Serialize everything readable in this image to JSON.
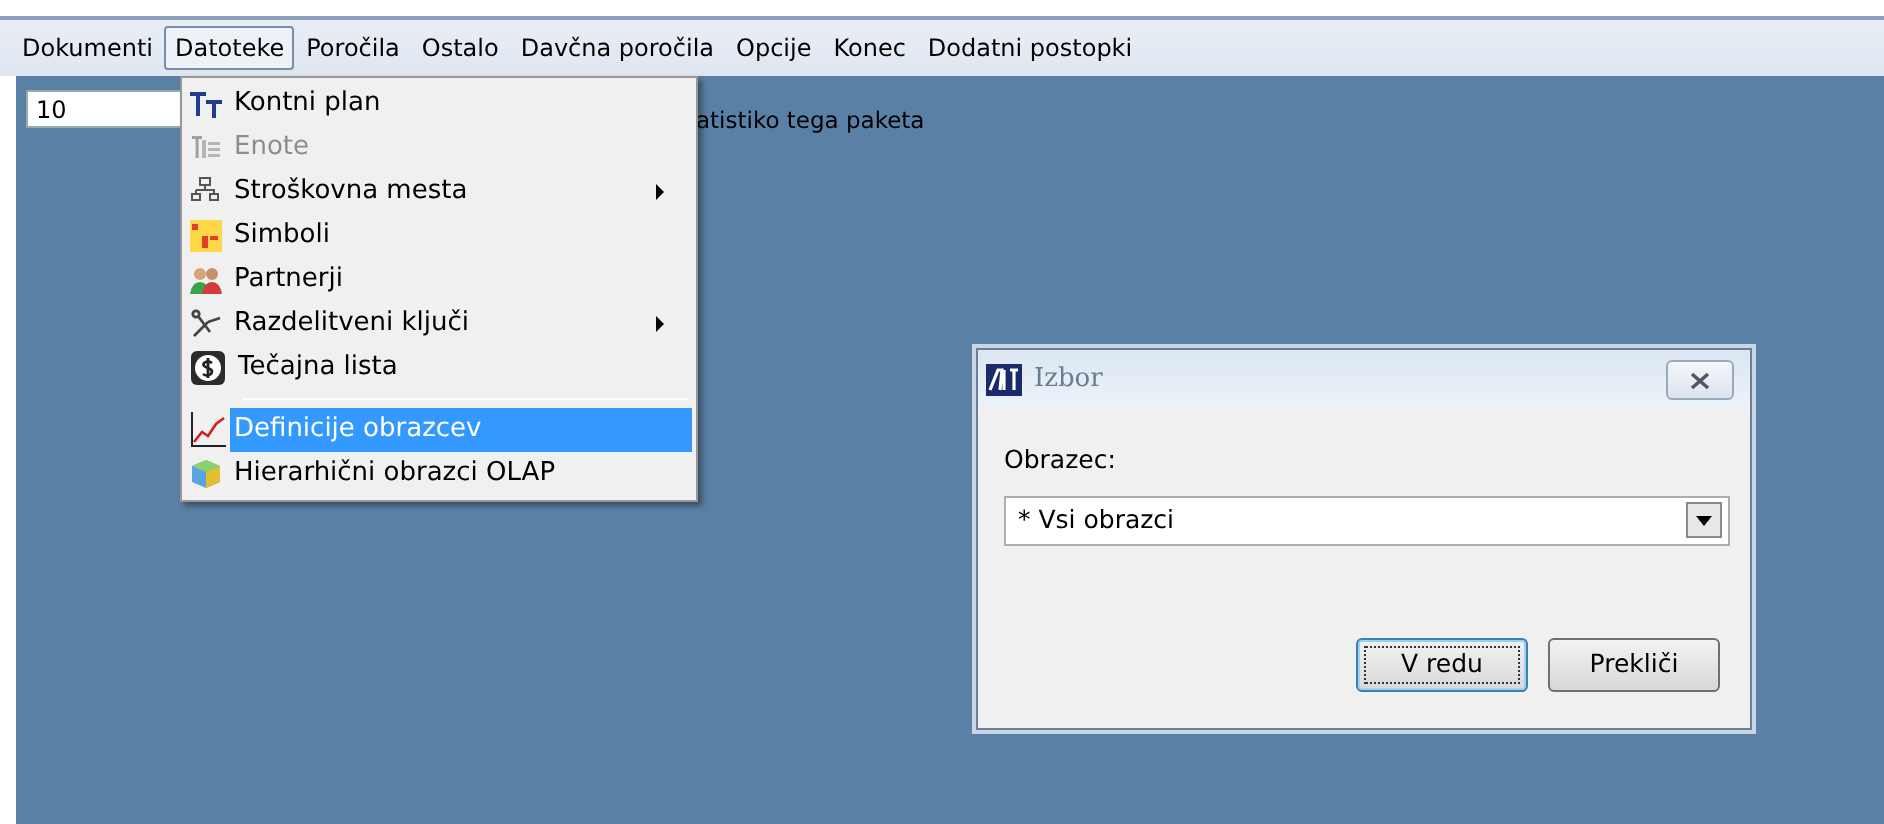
{
  "menu_bar": [
    {
      "label": "Dokumenti",
      "selected": false
    },
    {
      "label": "Datoteke",
      "selected": true
    },
    {
      "label": "Poročila",
      "selected": false
    },
    {
      "label": "Ostalo",
      "selected": false
    },
    {
      "label": "Davčna poročila",
      "selected": false
    },
    {
      "label": "Opcije",
      "selected": false
    },
    {
      "label": "Konec",
      "selected": false
    },
    {
      "label": "Dodatni postopki",
      "selected": false
    }
  ],
  "workspace": {
    "number_field": "10",
    "note": "atistiko tega paketa"
  },
  "dropdown_menu": [
    {
      "kind": "item",
      "label": "Kontni plan",
      "disabled": false,
      "submenu": false,
      "selected": false
    },
    {
      "kind": "item",
      "label": "Enote",
      "disabled": true,
      "submenu": false,
      "selected": false
    },
    {
      "kind": "item",
      "label": "Stroškovna mesta",
      "disabled": false,
      "submenu": true,
      "selected": false
    },
    {
      "kind": "item",
      "label": "Simboli",
      "disabled": false,
      "submenu": false,
      "selected": false
    },
    {
      "kind": "item",
      "label": "Partnerji",
      "disabled": false,
      "submenu": false,
      "selected": false
    },
    {
      "kind": "item",
      "label": "Razdelitveni ključi",
      "disabled": false,
      "submenu": true,
      "selected": false
    },
    {
      "kind": "item",
      "label": "Tečajna lista",
      "disabled": false,
      "submenu": false,
      "selected": false
    },
    {
      "kind": "separator"
    },
    {
      "kind": "item",
      "label": "Definicije obrazcev",
      "disabled": false,
      "submenu": false,
      "selected": true
    },
    {
      "kind": "item",
      "label": "Hierarhični obrazci OLAP",
      "disabled": false,
      "submenu": false,
      "selected": false
    }
  ],
  "dialog": {
    "title": "Izbor",
    "field_label": "Obrazec:",
    "select_value": "* Vsi obrazci",
    "buttons": [
      {
        "label": "V redu",
        "default": true
      },
      {
        "label": "Prekliči",
        "default": false
      }
    ]
  }
}
